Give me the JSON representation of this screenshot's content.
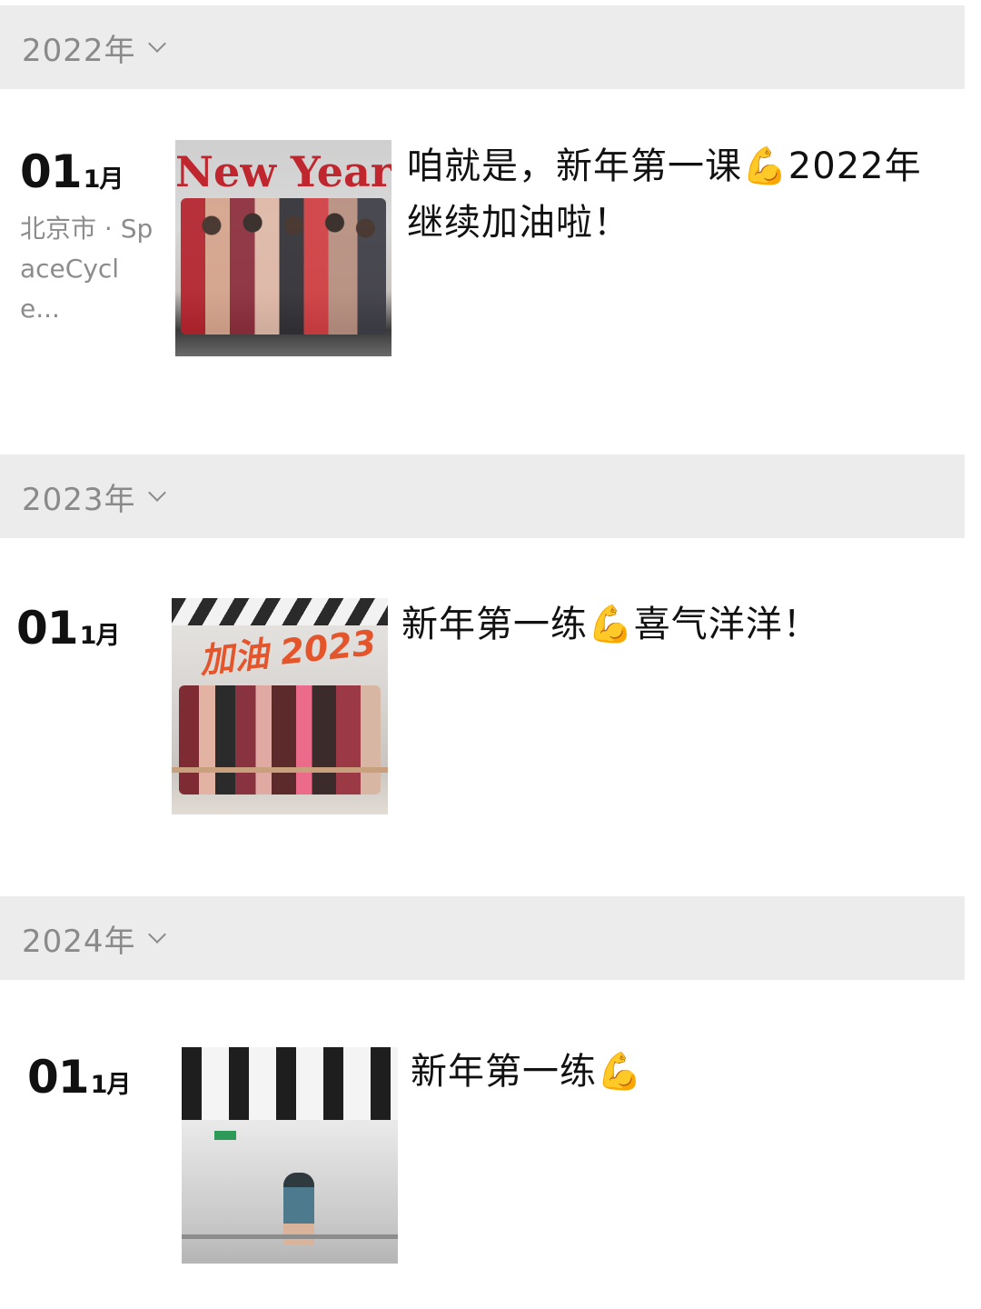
{
  "years": [
    {
      "label": "2022年",
      "post": {
        "day": "01",
        "month": "1月",
        "location": "北京市 · SpaceCycle...",
        "caption": "咱就是，新年第一课💪2022年继续加油啦！",
        "thumb_text": "New Year"
      }
    },
    {
      "label": "2023年",
      "post": {
        "day": "01",
        "month": "1月",
        "caption": "新年第一练💪喜气洋洋！",
        "thumb_text": "加油 2023"
      }
    },
    {
      "label": "2024年",
      "post": {
        "day": "01",
        "month": "1月",
        "caption": "新年第一练💪"
      }
    }
  ]
}
